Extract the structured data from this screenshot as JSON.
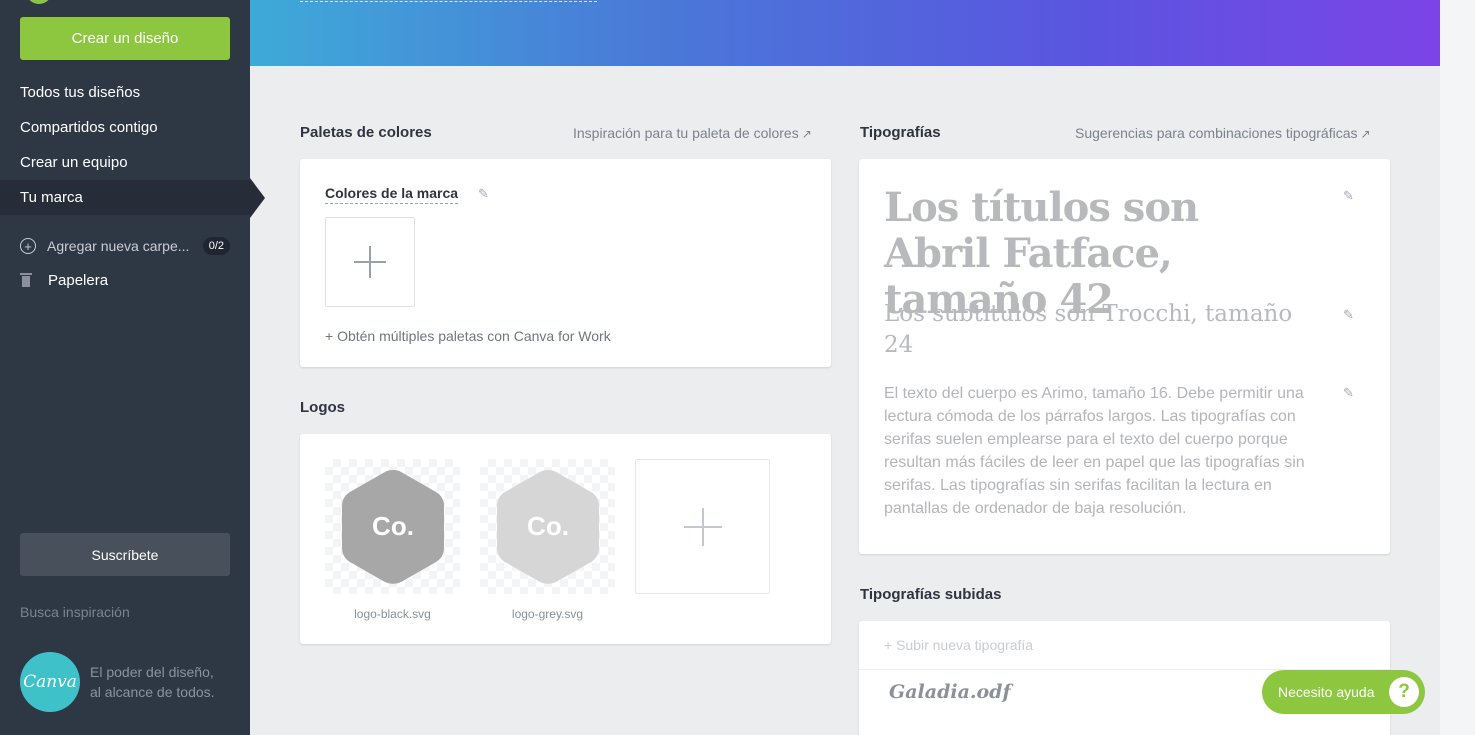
{
  "sidebar": {
    "create_button": "Crear un diseño",
    "nav": [
      {
        "label": "Todos tus diseños"
      },
      {
        "label": "Compartidos contigo"
      },
      {
        "label": "Crear un equipo"
      },
      {
        "label": "Tu marca"
      }
    ],
    "add_folder_label": "Agregar nueva carpe...",
    "folder_count": "0/2",
    "trash_label": "Papelera",
    "subscribe_button": "Suscríbete",
    "inspiration_link": "Busca inspiración",
    "logo_text": "Canva",
    "slogan_line1": "El poder del diseño,",
    "slogan_line2": "al alcance de todos."
  },
  "palettes": {
    "title": "Paletas de colores",
    "link": "Inspiración para tu paleta de colores",
    "brand_colors_label": "Colores de la marca",
    "more_palettes": "+ Obtén múltiples paletas con Canva for Work"
  },
  "logos": {
    "title": "Logos",
    "items": [
      {
        "name": "logo-black.svg",
        "text": "Co.",
        "color": "#a7a7a8"
      },
      {
        "name": "logo-grey.svg",
        "text": "Co.",
        "color": "#d6d6d7"
      }
    ]
  },
  "typography": {
    "title": "Tipografías",
    "link": "Sugerencias para combinaciones tipográficas",
    "heading_sample": "Los títulos son Abril Fatface, tamaño 42",
    "subheading_sample": "Los subtítulos son Trocchi, tamaño 24",
    "body_sample": "El texto del cuerpo es Arimo, tamaño 16. Debe permitir una lectura cómoda de los párrafos largos. Las tipografías con serifas suelen emplearse para el texto del cuerpo porque resultan más fáciles de leer en papel que las tipografías sin serifas. Las tipografías sin serifas facilitan la lectura en pantallas de ordenador de baja resolución."
  },
  "uploaded_fonts": {
    "title": "Tipografías subidas",
    "upload_label": "+ Subir nueva tipografía",
    "fonts": [
      {
        "name": "Galadia.odf"
      }
    ]
  },
  "help_button": {
    "label": "Necesito ayuda",
    "icon": "?"
  },
  "colors": {
    "accent_green": "#8dc63f",
    "sidebar_bg": "#2e3744",
    "banner_gradient_start": "#3eaad8",
    "banner_gradient_end": "#7c44e6"
  }
}
